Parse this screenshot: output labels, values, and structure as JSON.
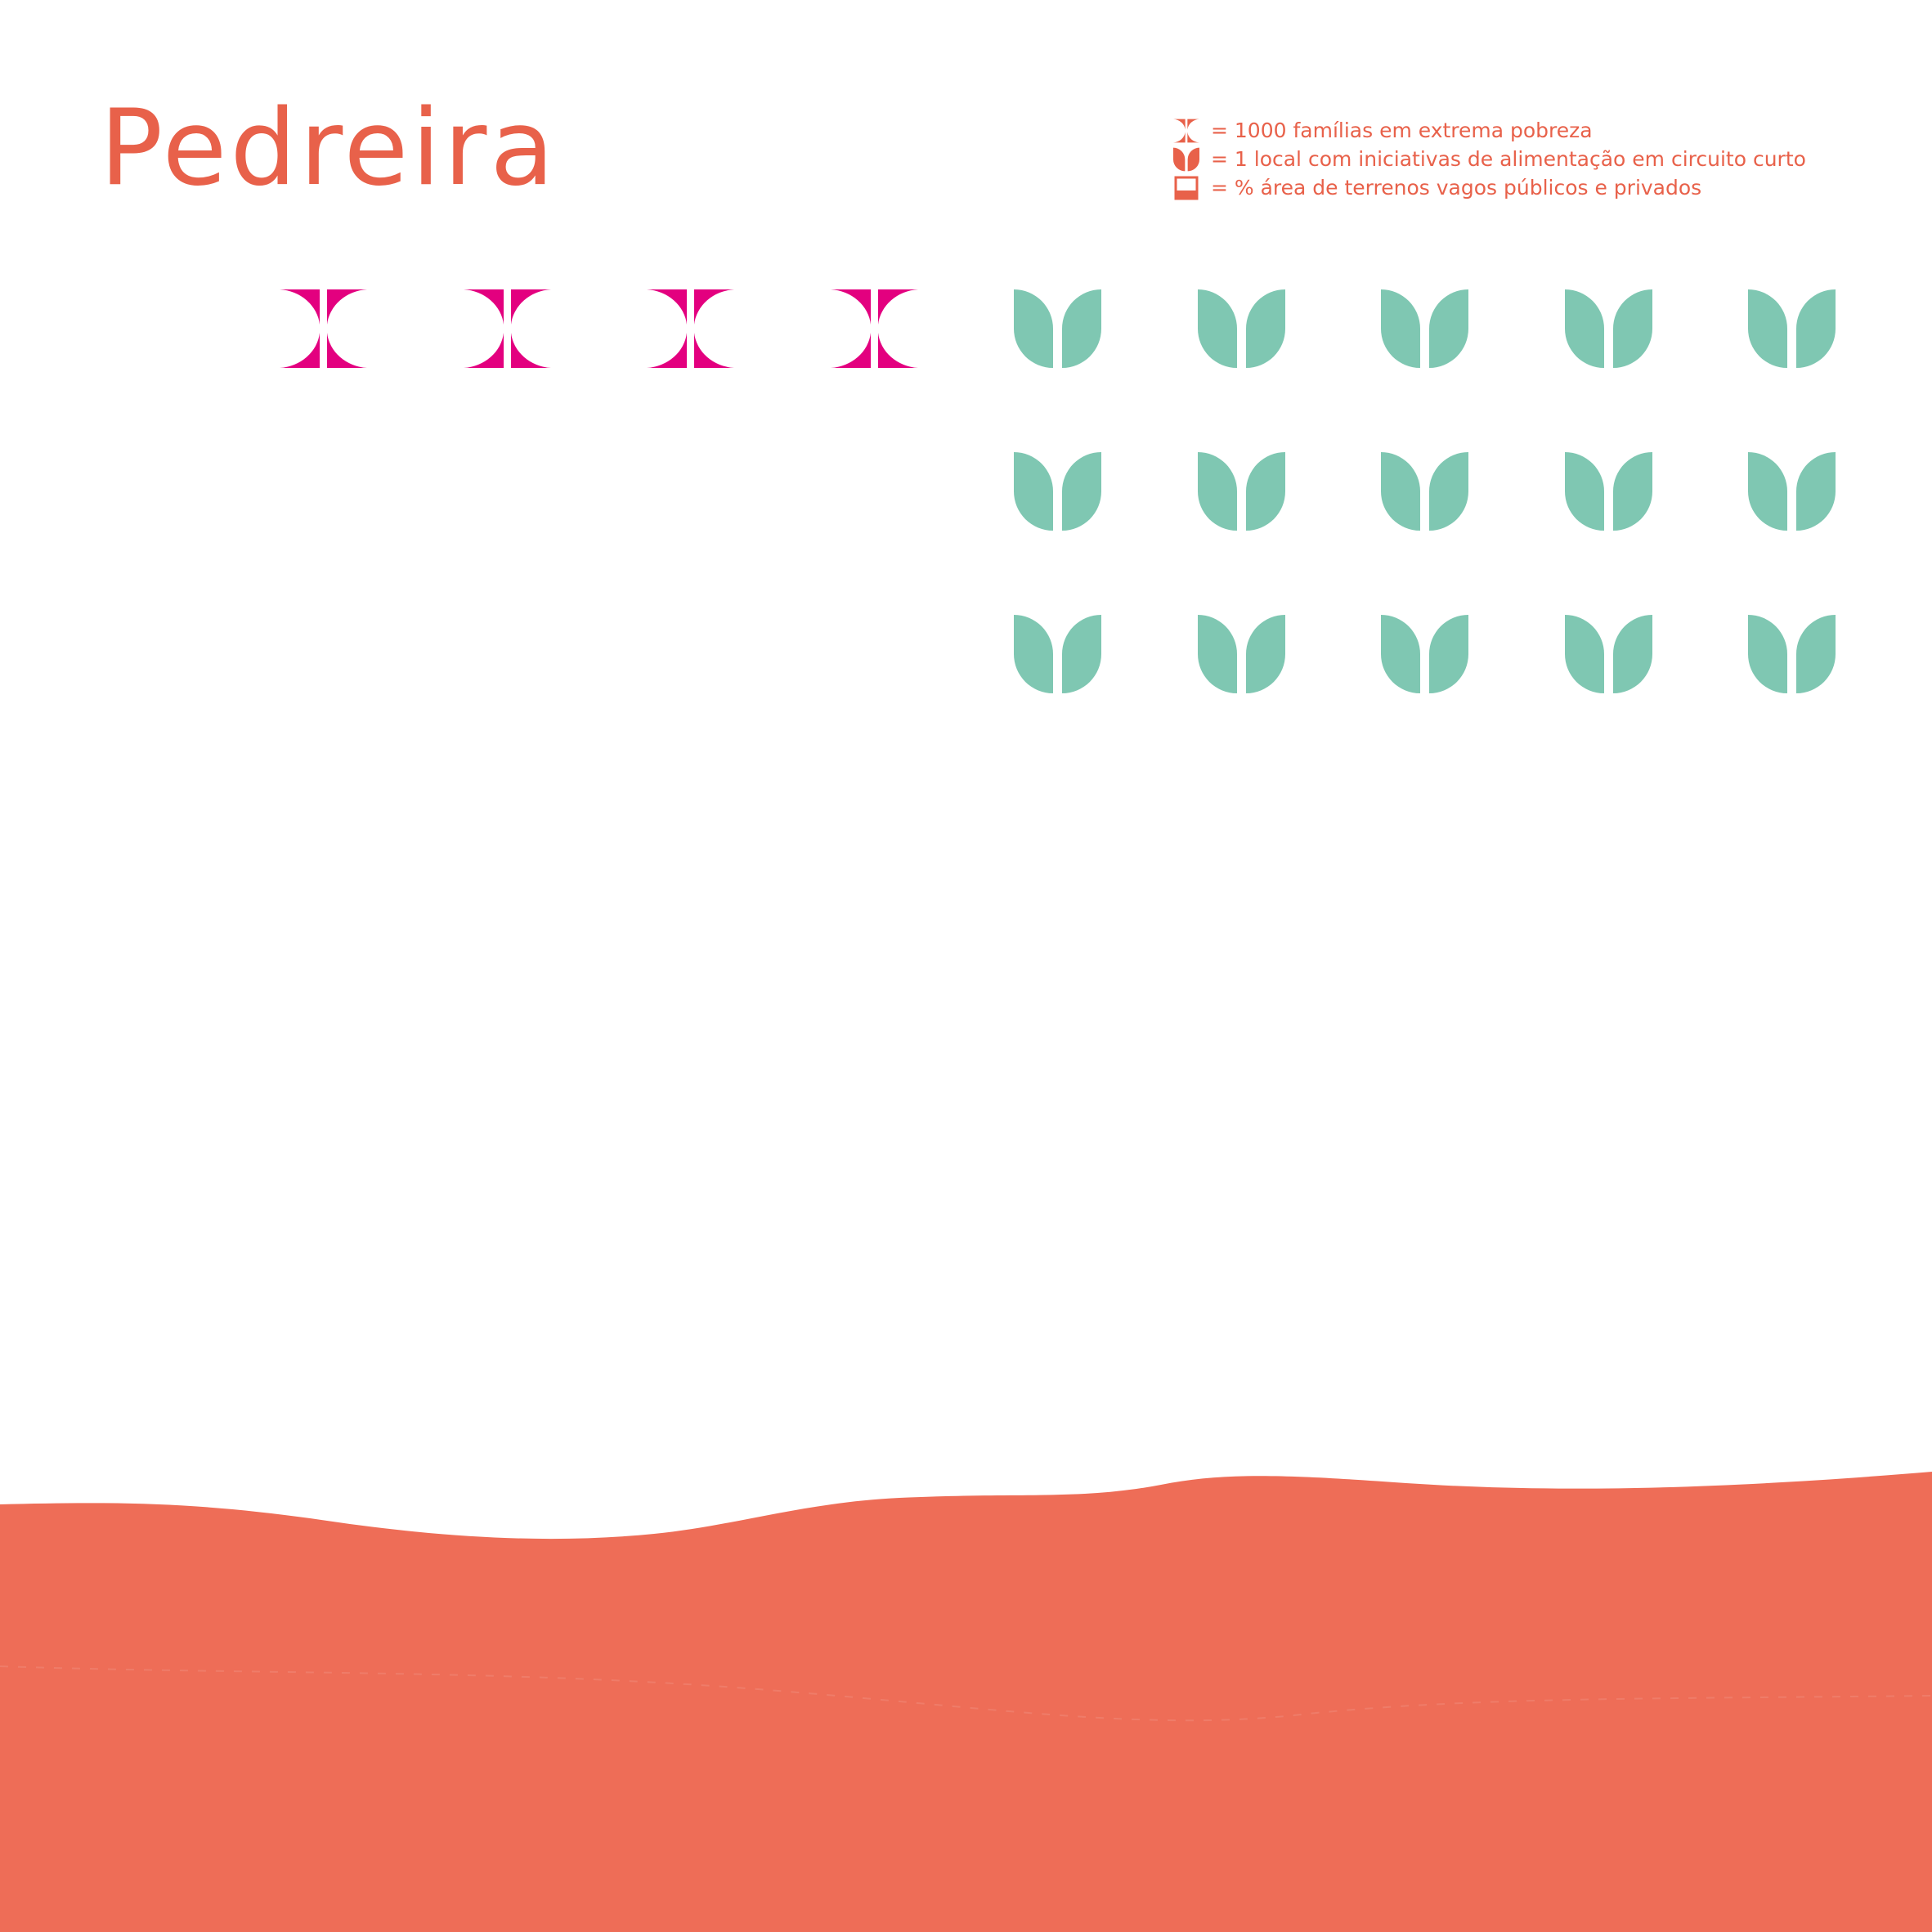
{
  "title": "Pedreira",
  "legend": [
    {
      "icon": "poverty-icon",
      "text": "= 1000 famílias em extrema pobreza"
    },
    {
      "icon": "leaf-icon",
      "text": "= 1 local com iniciativas de alimentação em circuito curto"
    },
    {
      "icon": "vacant-land-icon",
      "text": "= % área de terrenos vagos públicos e privados"
    }
  ],
  "colors": {
    "title": "#e8614a",
    "poverty": "#e3007f",
    "leaf": "#7fc7b2",
    "land": "#ee6d57"
  },
  "counts": {
    "families_thousands": 4,
    "short_circuit_sites": 15
  }
}
